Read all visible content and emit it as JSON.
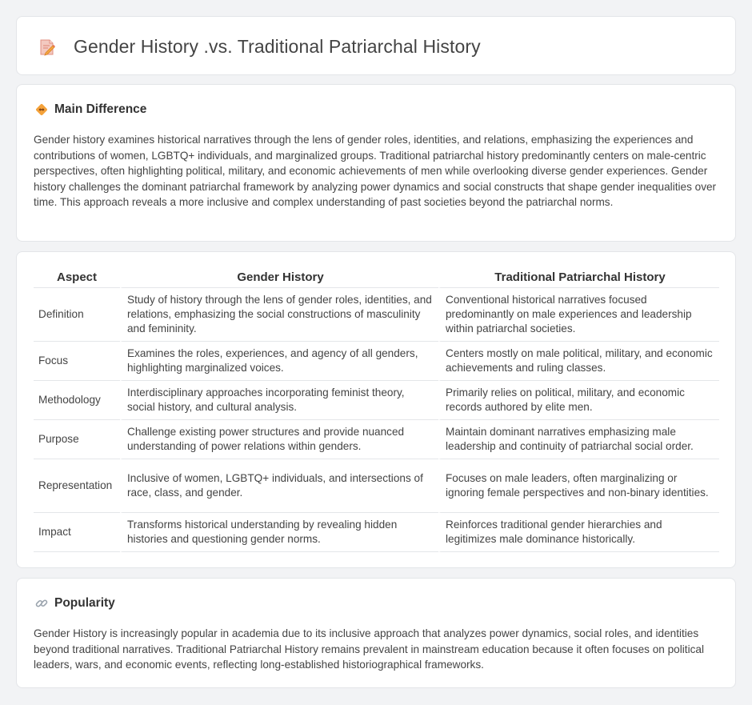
{
  "page": {
    "title": "Gender History .vs. Traditional Patriarchal History",
    "title_icon": "document-pencil-icon"
  },
  "main_difference": {
    "heading": "Main Difference",
    "icon": "diamond-arrows-icon",
    "text": "Gender history examines historical narratives through the lens of gender roles, identities, and relations, emphasizing the experiences and contributions of women, LGBTQ+ individuals, and marginalized groups. Traditional patriarchal history predominantly centers on male-centric perspectives, often highlighting political, military, and economic achievements of men while overlooking diverse gender experiences. Gender history challenges the dominant patriarchal framework by analyzing power dynamics and social constructs that shape gender inequalities over time. This approach reveals a more inclusive and complex understanding of past societies beyond the patriarchal norms."
  },
  "comparison": {
    "headers": [
      "Aspect",
      "Gender History",
      "Traditional Patriarchal History"
    ],
    "rows": [
      {
        "aspect": "Definition",
        "gender": "Study of history through the lens of gender roles, identities, and relations, emphasizing the social constructions of masculinity and femininity.",
        "patriarchal": "Conventional historical narratives focused predominantly on male experiences and leadership within patriarchal societies."
      },
      {
        "aspect": "Focus",
        "gender": "Examines the roles, experiences, and agency of all genders, highlighting marginalized voices.",
        "patriarchal": "Centers mostly on male political, military, and economic achievements and ruling classes."
      },
      {
        "aspect": "Methodology",
        "gender": "Interdisciplinary approaches incorporating feminist theory, social history, and cultural analysis.",
        "patriarchal": "Primarily relies on political, military, and economic records authored by elite men."
      },
      {
        "aspect": "Purpose",
        "gender": "Challenge existing power structures and provide nuanced understanding of power relations within genders.",
        "patriarchal": "Maintain dominant narratives emphasizing male leadership and continuity of patriarchal social order."
      },
      {
        "aspect": "Representation",
        "gender": "Inclusive of women, LGBTQ+ individuals, and intersections of race, class, and gender.",
        "patriarchal": "Focuses on male leaders, often marginalizing or ignoring female perspectives and non-binary identities."
      },
      {
        "aspect": "Impact",
        "gender": "Transforms historical understanding by revealing hidden histories and questioning gender norms.",
        "patriarchal": "Reinforces traditional gender hierarchies and legitimizes male dominance historically."
      }
    ]
  },
  "popularity": {
    "heading": "Popularity",
    "icon": "link-icon",
    "text": "Gender History is increasingly popular in academia due to its inclusive approach that analyzes power dynamics, social roles, and identities beyond traditional narratives. Traditional Patriarchal History remains prevalent in mainstream education because it often focuses on political leaders, wars, and economic events, reflecting long-established historiographical frameworks."
  },
  "colors": {
    "background": "#f2f3f5",
    "card": "#ffffff",
    "border": "#e3e5e8",
    "accent_orange": "#f0a030"
  }
}
